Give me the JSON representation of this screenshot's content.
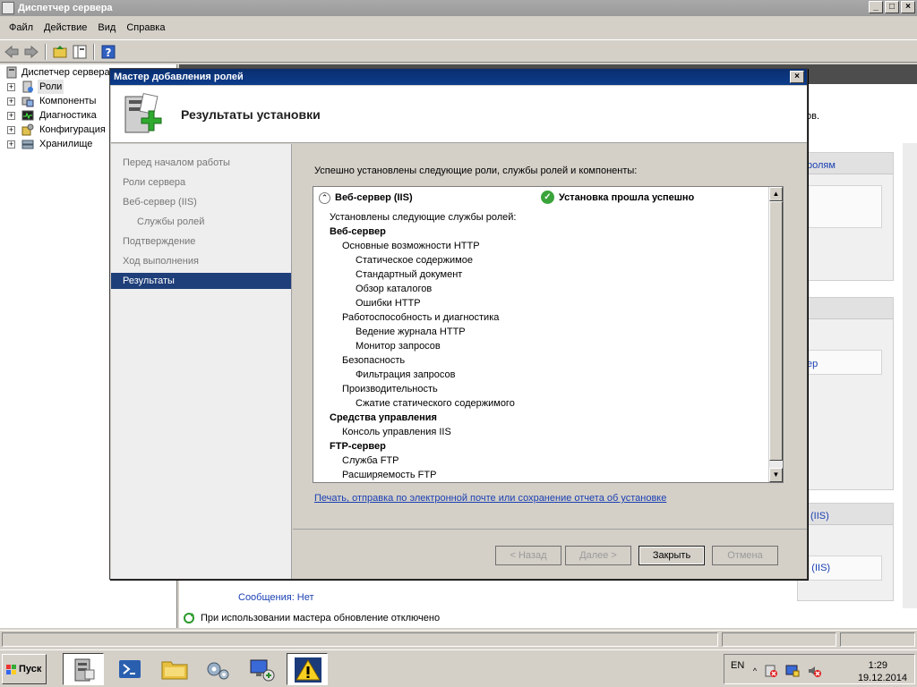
{
  "window": {
    "title": "Диспетчер сервера",
    "controls": [
      "_",
      "□",
      "×"
    ]
  },
  "menubar": [
    "Файл",
    "Действие",
    "Вид",
    "Справка"
  ],
  "tree": {
    "root": "Диспетчер сервера",
    "items": [
      "Роли",
      "Компоненты",
      "Диагностика",
      "Конфигурация",
      "Хранилище"
    ]
  },
  "right_pane": {
    "frag_text1": "ов.",
    "frag_link1": "ролям",
    "frag_link2": "ер",
    "frag_link3": "(IIS)",
    "frag_link4": "ер (IIS)",
    "messages": "Сообщения: Нет"
  },
  "status_line": "При использовании мастера обновление отключено",
  "dialog": {
    "title": "Мастер добавления ролей",
    "close": "×",
    "header_title": "Результаты установки",
    "nav": [
      "Перед началом работы",
      "Роли сервера",
      "Веб-сервер (IIS)",
      "Службы ролей",
      "Подтверждение",
      "Ход выполнения",
      "Результаты"
    ],
    "intro": "Успешно установлены следующие роли, службы ролей и компоненты:",
    "result": {
      "role_name": "Веб-сервер (IIS)",
      "status": "Установка прошла успешно",
      "lines": [
        {
          "text": "Установлены следующие службы ролей:",
          "level": 0,
          "bold": false
        },
        {
          "text": "Веб-сервер",
          "level": 0,
          "bold": true
        },
        {
          "text": "Основные возможности HTTP",
          "level": 1,
          "bold": false
        },
        {
          "text": "Статическое содержимое",
          "level": 2,
          "bold": false
        },
        {
          "text": "Стандартный документ",
          "level": 2,
          "bold": false
        },
        {
          "text": "Обзор каталогов",
          "level": 2,
          "bold": false
        },
        {
          "text": "Ошибки HTTP",
          "level": 2,
          "bold": false
        },
        {
          "text": "Работоспособность и диагностика",
          "level": 1,
          "bold": false
        },
        {
          "text": "Ведение журнала HTTP",
          "level": 2,
          "bold": false
        },
        {
          "text": "Монитор запросов",
          "level": 2,
          "bold": false
        },
        {
          "text": "Безопасность",
          "level": 1,
          "bold": false
        },
        {
          "text": "Фильтрация запросов",
          "level": 2,
          "bold": false
        },
        {
          "text": "Производительность",
          "level": 1,
          "bold": false
        },
        {
          "text": "Сжатие статического содержимого",
          "level": 2,
          "bold": false
        },
        {
          "text": "Средства управления",
          "level": 0,
          "bold": true
        },
        {
          "text": "Консоль управления IIS",
          "level": 1,
          "bold": false
        },
        {
          "text": "FTP-сервер",
          "level": 0,
          "bold": true
        },
        {
          "text": "Служба FTP",
          "level": 1,
          "bold": false
        },
        {
          "text": "Расширяемость FTP",
          "level": 1,
          "bold": false
        }
      ]
    },
    "report_link": "Печать, отправка по электронной почте или сохранение отчета об установке",
    "buttons": {
      "back": "< Назад",
      "next": "Далее >",
      "close": "Закрыть",
      "cancel": "Отмена"
    }
  },
  "taskbar": {
    "start": "Пуск",
    "lang": "EN",
    "time": "1:29",
    "date": "19.12.2014"
  },
  "colors": {
    "dialog_title": "#0c3c8c",
    "nav_active": "#1f3f7a",
    "link": "#1a3fb3",
    "success": "#3aa43a"
  }
}
